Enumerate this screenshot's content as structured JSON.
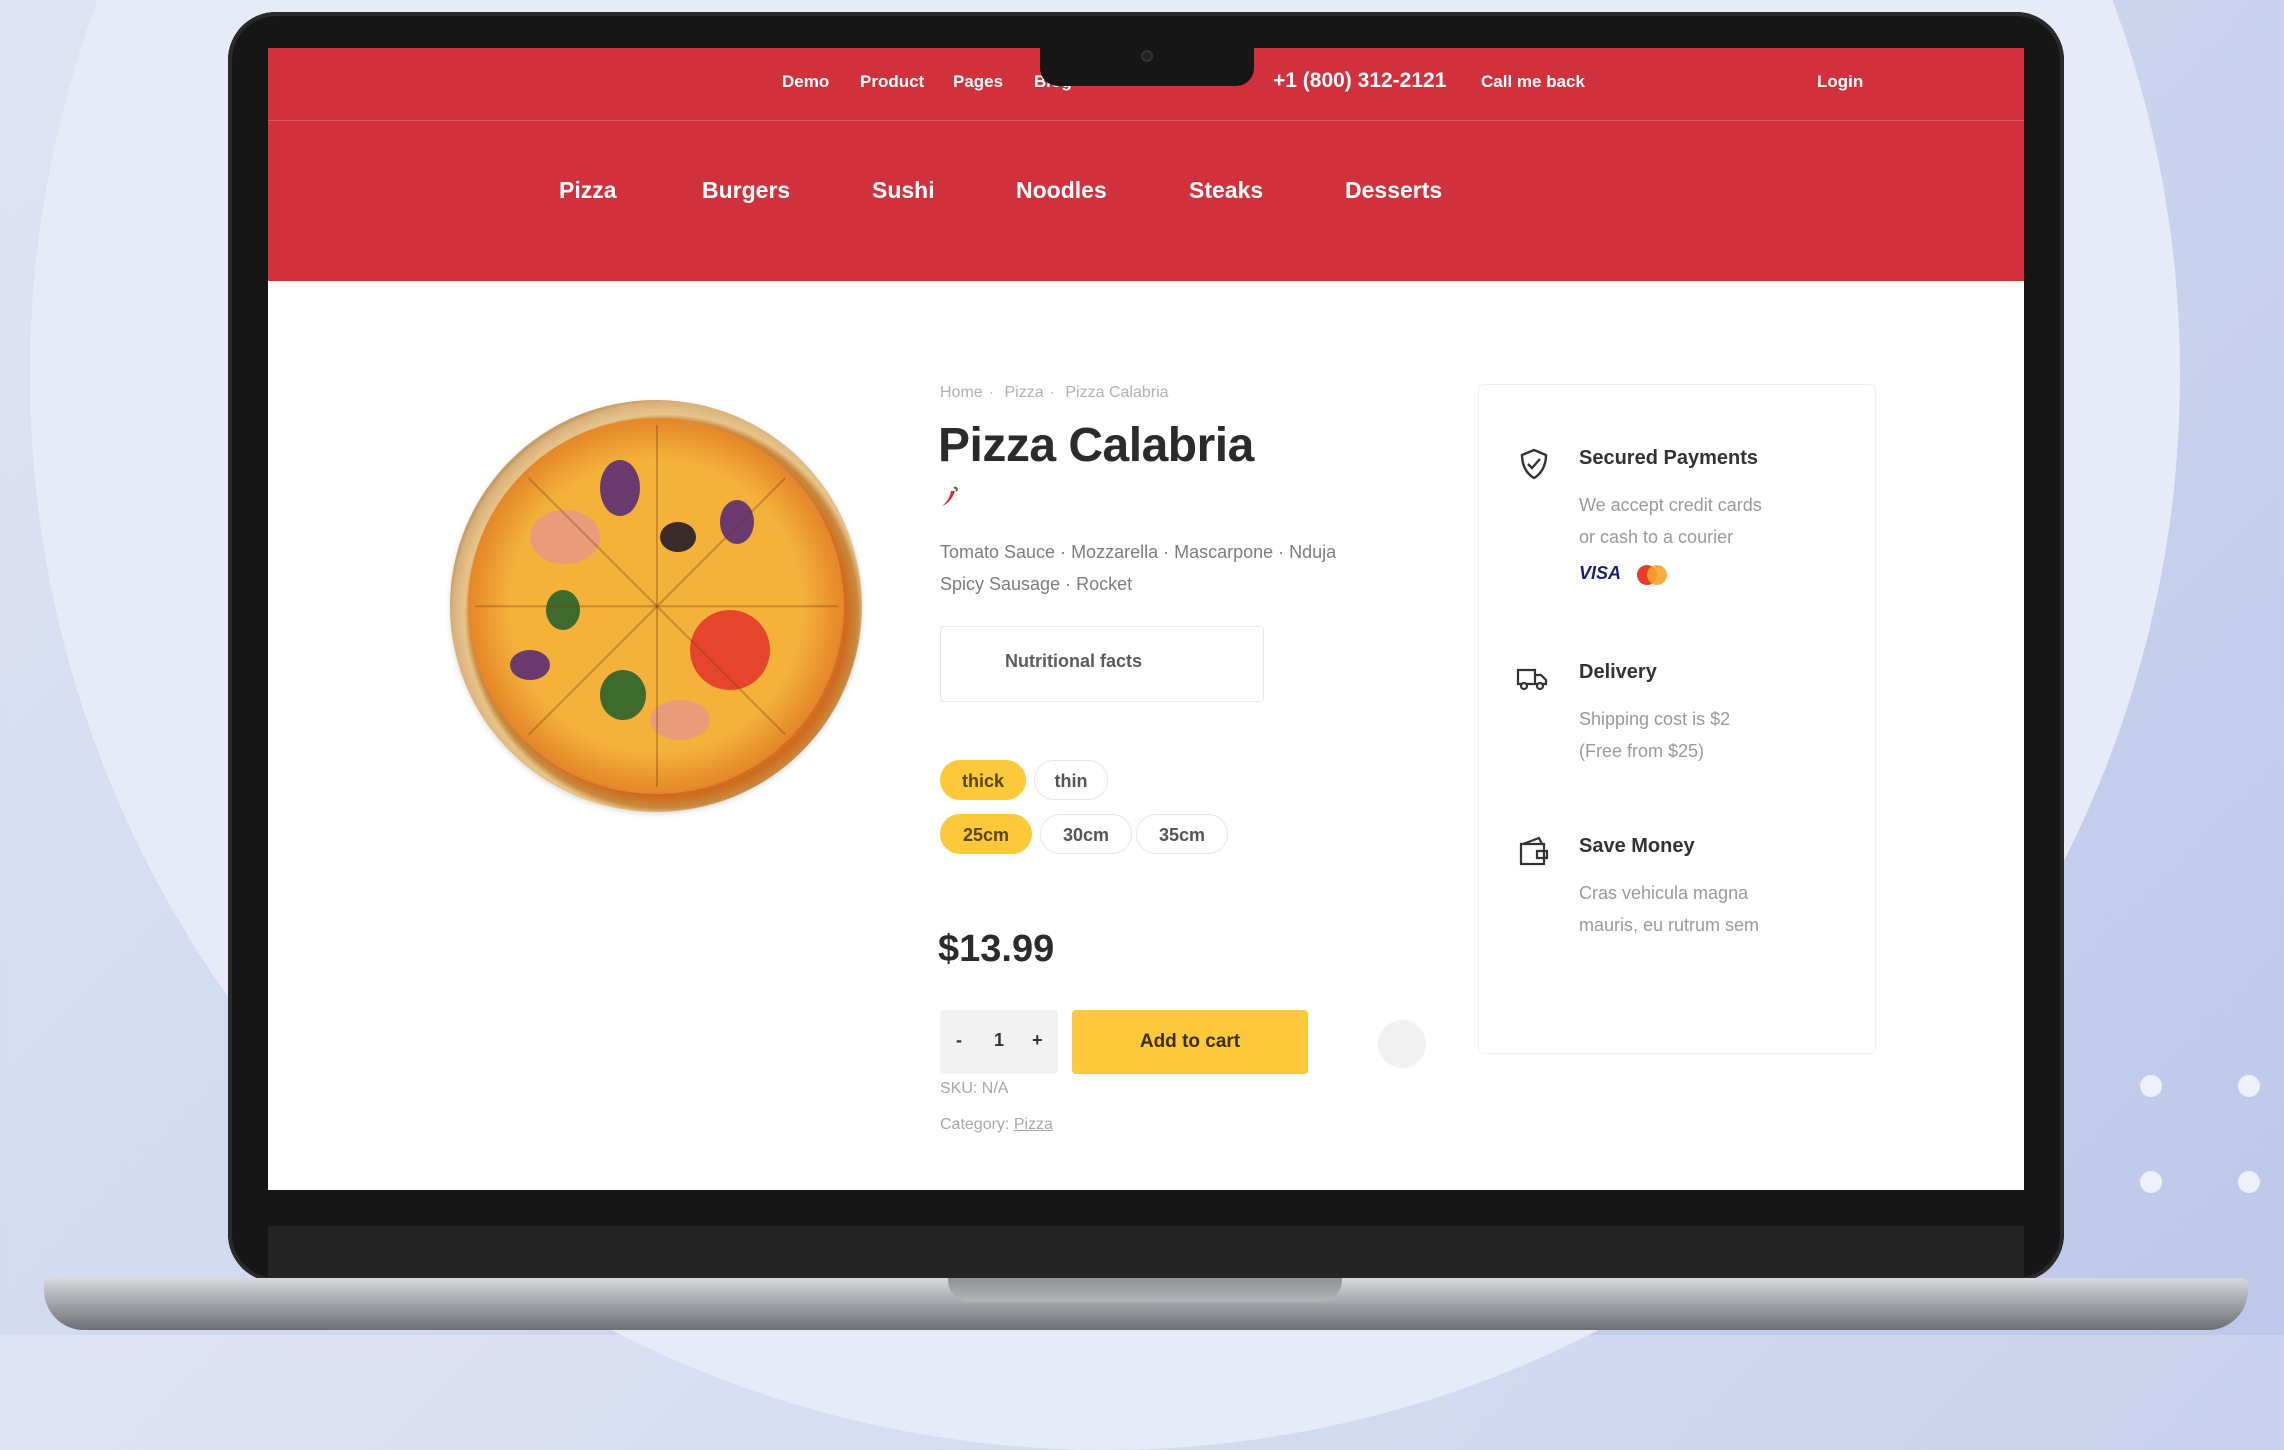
{
  "topbar": {
    "links": [
      "Demo",
      "Product",
      "Pages",
      "Blog"
    ],
    "phone": "+1 (800) 312-2121",
    "callback": "Call me back",
    "login": "Login"
  },
  "categories": [
    "Pizza",
    "Burgers",
    "Sushi",
    "Noodles",
    "Steaks",
    "Desserts"
  ],
  "product": {
    "breadcrumb": [
      "Home",
      "Pizza",
      "Pizza Calabria"
    ],
    "title": "Pizza Calabria",
    "spicy_icon": "chili-pepper-icon",
    "ingredients_line1": "Tomato Sauce · Mozzarella · Mascarpone · Nduja",
    "ingredients_line2": "Spicy Sausage · Rocket",
    "nutritional_button": "Nutritional facts",
    "crust_options": [
      {
        "label": "thick",
        "selected": true
      },
      {
        "label": "thin",
        "selected": false
      }
    ],
    "size_options": [
      {
        "label": "25cm",
        "selected": true
      },
      {
        "label": "30cm",
        "selected": false
      },
      {
        "label": "35cm",
        "selected": false
      }
    ],
    "price": "$13.99",
    "quantity": {
      "minus": "-",
      "value": "1",
      "plus": "+"
    },
    "add_to_cart": "Add to cart",
    "sku": "SKU: N/A",
    "category_label": "Category:",
    "category_value": "Pizza"
  },
  "features": [
    {
      "icon": "shield-check-icon",
      "title": "Secured Payments",
      "line1": "We accept credit cards",
      "line2": "or cash to a courier"
    },
    {
      "icon": "delivery-truck-icon",
      "title": "Delivery",
      "line1": "Shipping cost is $2",
      "line2": "(Free from $25)"
    },
    {
      "icon": "wallet-icon",
      "title": "Save Money",
      "line1": "Cras vehicula magna",
      "line2": "mauris, eu rutrum sem"
    }
  ],
  "payment_logos": {
    "visa": "VISA",
    "mastercard": "mastercard-icon"
  },
  "colors": {
    "brand_red": "#d0313c",
    "accent_yellow": "#fcc93a"
  }
}
